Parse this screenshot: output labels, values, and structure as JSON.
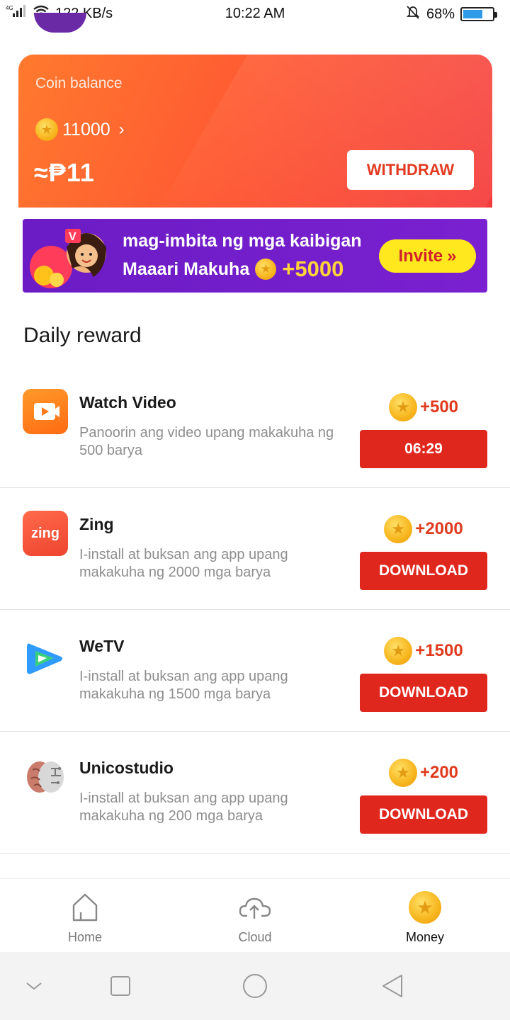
{
  "status_bar": {
    "network": "4G",
    "speed": "122 KB/s",
    "time": "10:22 AM",
    "battery": "68%",
    "battery_level": 0.68
  },
  "balance_card": {
    "label": "Coin balance",
    "coins": "11000",
    "peso": "≈₱11",
    "withdraw_label": "WITHDRAW"
  },
  "invite_banner": {
    "line1": "mag-imbita ng mga kaibigan",
    "line2": "Maaari Makuha",
    "bonus": "+5000",
    "button_label": "Invite",
    "button_icon": "double-chevron-right-icon"
  },
  "daily_reward": {
    "title": "Daily reward",
    "items": [
      {
        "title": "Watch Video",
        "description": "Panoorin ang video upang makakuha ng 500 barya",
        "reward": "+500",
        "button": "06:29",
        "icon": "video-play-icon",
        "color": "#ff7a1a"
      },
      {
        "title": "Zing",
        "description": "I-install at buksan ang app upang makakuha ng 2000 mga barya",
        "reward": "+2000",
        "button": "DOWNLOAD",
        "icon": "zing-app-icon",
        "color": "#f4553a",
        "icon_text": "zing"
      },
      {
        "title": "WeTV",
        "description": "I-install at buksan ang app upang makakuha ng 1500 mga barya",
        "reward": "+1500",
        "button": "DOWNLOAD",
        "icon": "wetv-app-icon",
        "color": "#2f9bff"
      },
      {
        "title": "Unicostudio",
        "description": "I-install at buksan ang app upang makakuha ng 200 mga barya",
        "reward": "+200",
        "button": "DOWNLOAD",
        "icon": "brain-app-icon",
        "color": "#c98a7c"
      }
    ]
  },
  "bottom_nav": {
    "items": [
      {
        "label": "Home",
        "icon": "home-icon"
      },
      {
        "label": "Cloud",
        "icon": "cloud-upload-icon"
      },
      {
        "label": "Money",
        "icon": "coin-icon",
        "active": true
      }
    ]
  },
  "colors": {
    "accent": "#e0271d",
    "card_start": "#ff7a2e",
    "card_end": "#f43b3c",
    "banner": "#6b1cc5",
    "invite_button": "#ffe81e"
  }
}
